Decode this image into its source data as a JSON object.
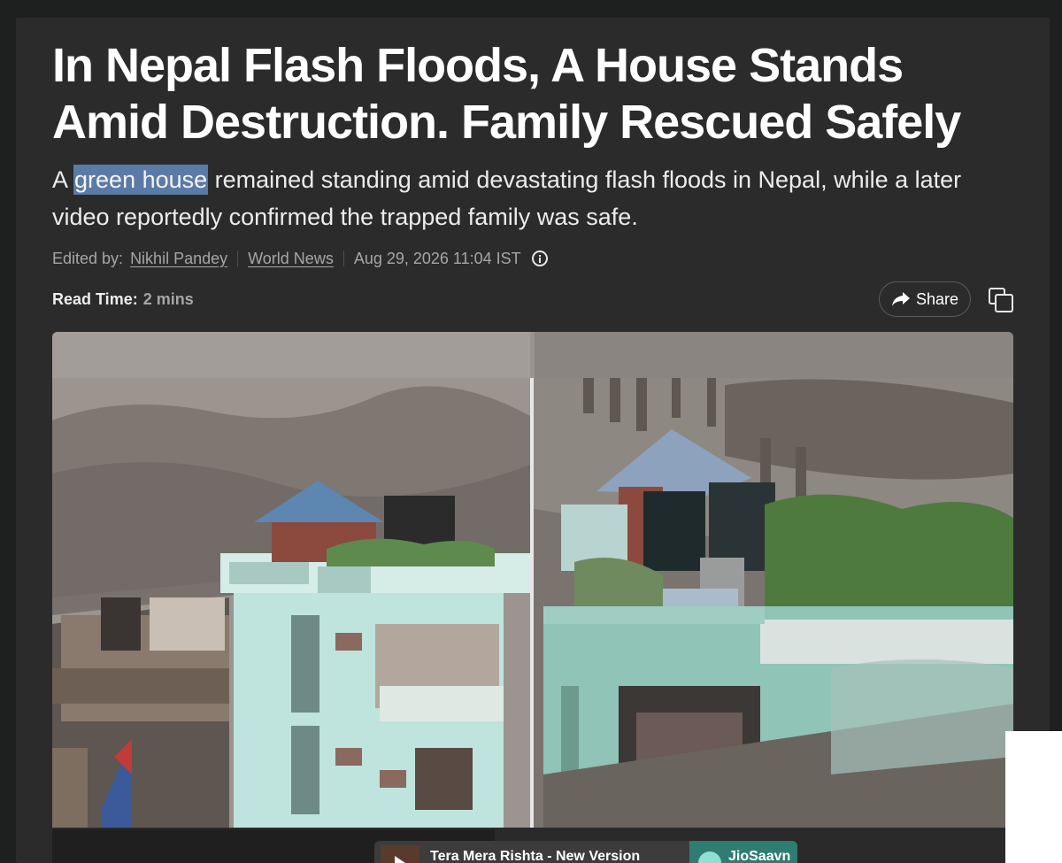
{
  "article": {
    "headline_line1": "In Nepal Flash Floods, A House Stands",
    "headline_line2": "Amid Destruction. Family Rescued Safely",
    "summary_prefix": "A ",
    "summary_highlight": "green house",
    "summary_rest": " remained standing amid devastating flash floods in Nepal, while a later video reportedly confirmed the trapped family was safe."
  },
  "meta": {
    "edited_by_label": "Edited by:",
    "editor": "Nikhil Pandey",
    "category": "World News",
    "timestamp": "Aug 29, 2026 11:04 IST",
    "info_icon": "info-icon"
  },
  "read_time": {
    "label": "Read Time:",
    "value": "2 mins"
  },
  "actions": {
    "share_label": "Share",
    "share_icon": "share-arrow-icon",
    "copy_icon": "copy-icon"
  },
  "player": {
    "title": "Tera Mera Rishta - New Version",
    "brand": "JioSaavn"
  },
  "colors": {
    "page_bg": "#1e1f1f",
    "card_bg": "#2b2b2b",
    "highlight": "#5a7aa8",
    "muted_text": "#a6a6a6"
  }
}
